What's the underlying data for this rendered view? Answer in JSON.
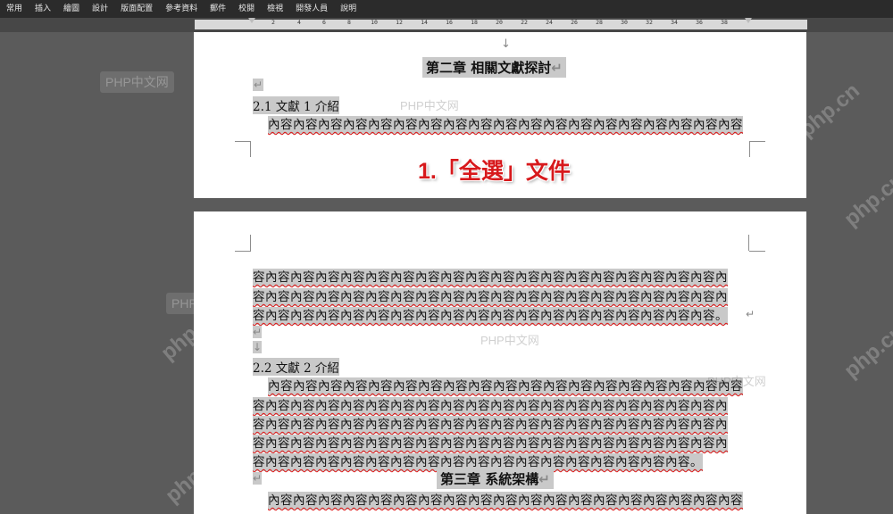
{
  "ribbon": {
    "tabs": [
      "常用",
      "插入",
      "繪圖",
      "設計",
      "版面配置",
      "參考資料",
      "郵件",
      "校閱",
      "檢視",
      "開發人員",
      "說明"
    ]
  },
  "ruler": {
    "marks": [
      "2",
      "4",
      "6",
      "8",
      "10",
      "12",
      "14",
      "16",
      "18",
      "20",
      "22",
      "24",
      "26",
      "28",
      "30",
      "32",
      "34",
      "36",
      "38"
    ]
  },
  "page1": {
    "top_mark": "↓",
    "chapter2_heading": "第二章  相關文獻探討",
    "para_mark": "↵",
    "section_2_1": "2.1 文獻 1 介紹",
    "body_line": "內容內容內容內容內容內容內容內容內容內容內容內容內容內容內容內容內容內容內容"
  },
  "overlay_text": "1.「全選」文件",
  "page2": {
    "lines_a": [
      "容內容內容內容內容內容內容內容內容內容內容內容內容內容內容內容內容內容內容內",
      "容內容內容內容內容內容內容內容內容內容內容內容內容內容內容內容內容內容內容內",
      "容內容內容內容內容內容內容內容內容內容內容內容內容內容內容內容內容內容內容。"
    ],
    "section_2_2": "2.2 文獻 2 介紹",
    "lines_b": [
      "內容內容內容內容內容內容內容內容內容內容內容內容內容內容內容內容內容內容內容",
      "容內容內容內容內容內容內容內容內容內容內容內容內容內容內容內容內容內容內容內",
      "容內容內容內容內容內容內容內容內容內容內容內容內容內容內容內容內容內容內容內",
      "容內容內容內容內容內容內容內容內容內容內容內容內容內容內容內容內容內容內容內",
      "容內容內容內容內容內容內容內容內容內容內容內容內容內容內容內容內容內容。"
    ],
    "chapter3_heading": "第三章  系統架構",
    "lines_c": [
      "內容內容內容內容內容內容內容內容內容內容內容內容內容內容內容內容內容內容內容"
    ]
  },
  "watermarks": {
    "php_cn_cn": "PHP中文网",
    "php_cn": "php.cn"
  }
}
